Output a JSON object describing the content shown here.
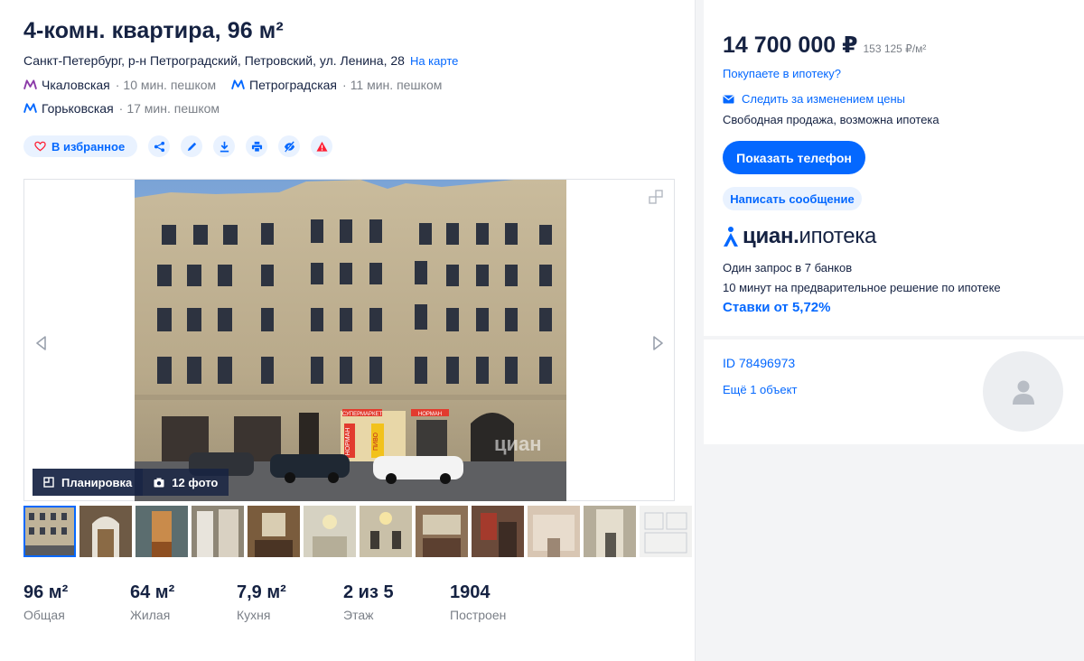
{
  "listing": {
    "title": "4-комн. квартира, 96 м²",
    "address": "Санкт-Петербург, р-н Петроградский, Петровский, ул. Ленина, 28",
    "map_link": "На карте",
    "metro": [
      {
        "name": "Чкаловская",
        "walk": "10 мин. пешком",
        "color": "#8b3aa8"
      },
      {
        "name": "Петроградская",
        "walk": "11 мин. пешком",
        "color": "#0468ff"
      },
      {
        "name": "Горьковская",
        "walk": "17 мин. пешком",
        "color": "#0468ff"
      }
    ],
    "favorite_label": "В избранное"
  },
  "gallery": {
    "plan_label": "Планировка",
    "photos_label": "12 фото",
    "watermark": "циан",
    "shop_sign_1": "СУПЕРМАРКЕТ",
    "shop_sign_2": "НОРМАН",
    "shop_sign_3": "ПИВО",
    "shop_sign_4": "НОРМАН"
  },
  "stats": [
    {
      "value": "96 м²",
      "label": "Общая"
    },
    {
      "value": "64 м²",
      "label": "Жилая"
    },
    {
      "value": "7,9 м²",
      "label": "Кухня"
    },
    {
      "value": "2 из 5",
      "label": "Этаж"
    },
    {
      "value": "1904",
      "label": "Построен"
    }
  ],
  "sidebar": {
    "price": "14 700 000 ₽",
    "price_per_m": "153 125 ₽/м²",
    "mortgage_link": "Покупаете в ипотеку?",
    "track_price": "Следить за изменением цены",
    "sale_type": "Свободная продажа, возможна ипотека",
    "phone_button": "Показать телефон",
    "message_button": "Написать сообщение",
    "logo_main": "циан",
    "logo_sub": "ипотека",
    "promo_line1": "Один запрос в 7 банков",
    "promo_line2": "10 минут на предварительное решение по ипотеке",
    "rates": "Ставки от 5,72%",
    "agent_id": "ID 78496973",
    "agent_more": "Ещё 1 объект"
  },
  "colors": {
    "accent": "#0468ff",
    "text": "#152242",
    "muted": "#7a7f87",
    "danger": "#ff1f34"
  }
}
